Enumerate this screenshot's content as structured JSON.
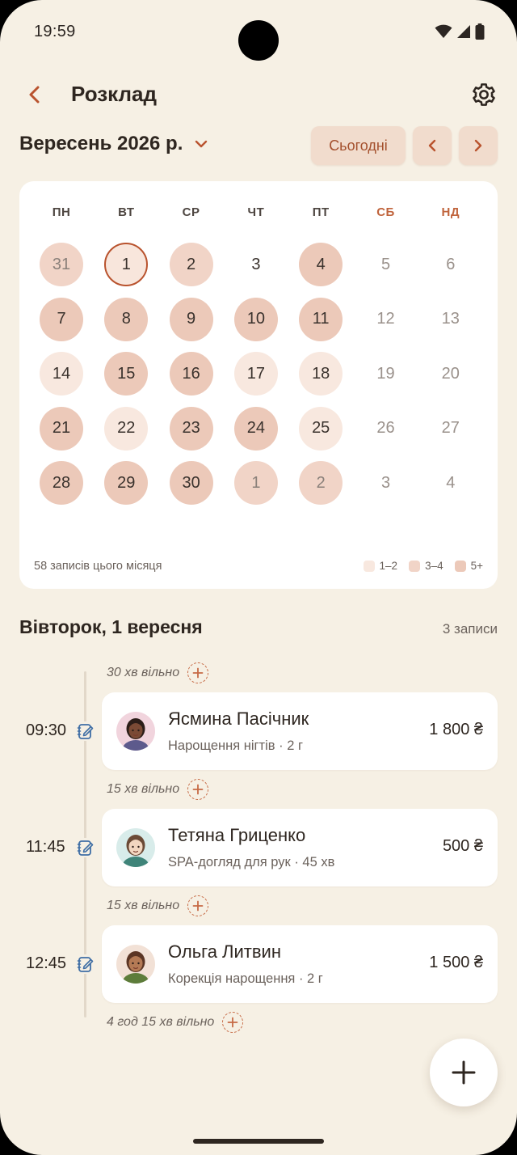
{
  "status_bar": {
    "time": "19:59",
    "icons": [
      "wifi-icon",
      "signal-icon",
      "battery-icon"
    ]
  },
  "header": {
    "title": "Розклад",
    "back_icon": "chevron-left-icon",
    "settings_icon": "gear-icon"
  },
  "month_nav": {
    "label": "Вересень 2026 р.",
    "today_label": "Сьогодні",
    "prev_icon": "chevron-left-icon",
    "next_icon": "chevron-right-icon"
  },
  "calendar": {
    "weekdays": [
      {
        "label": "ПН",
        "weekend": false
      },
      {
        "label": "ВТ",
        "weekend": false
      },
      {
        "label": "СР",
        "weekend": false
      },
      {
        "label": "ЧТ",
        "weekend": false
      },
      {
        "label": "ПТ",
        "weekend": false
      },
      {
        "label": "СБ",
        "weekend": true
      },
      {
        "label": "НД",
        "weekend": true
      }
    ],
    "weeks": [
      [
        {
          "d": "31",
          "level": 2,
          "other": true
        },
        {
          "d": "1",
          "level": 1,
          "selected": true
        },
        {
          "d": "2",
          "level": 2
        },
        {
          "d": "3",
          "level": 0
        },
        {
          "d": "4",
          "level": 3
        },
        {
          "d": "5",
          "level": 0,
          "muted": true
        },
        {
          "d": "6",
          "level": 0,
          "muted": true
        }
      ],
      [
        {
          "d": "7",
          "level": 3
        },
        {
          "d": "8",
          "level": 3
        },
        {
          "d": "9",
          "level": 3
        },
        {
          "d": "10",
          "level": 3
        },
        {
          "d": "11",
          "level": 3
        },
        {
          "d": "12",
          "level": 0,
          "muted": true
        },
        {
          "d": "13",
          "level": 0,
          "muted": true
        }
      ],
      [
        {
          "d": "14",
          "level": 1
        },
        {
          "d": "15",
          "level": 3
        },
        {
          "d": "16",
          "level": 3
        },
        {
          "d": "17",
          "level": 1
        },
        {
          "d": "18",
          "level": 1
        },
        {
          "d": "19",
          "level": 0,
          "muted": true
        },
        {
          "d": "20",
          "level": 0,
          "muted": true
        }
      ],
      [
        {
          "d": "21",
          "level": 3
        },
        {
          "d": "22",
          "level": 1
        },
        {
          "d": "23",
          "level": 3
        },
        {
          "d": "24",
          "level": 3
        },
        {
          "d": "25",
          "level": 1
        },
        {
          "d": "26",
          "level": 0,
          "muted": true
        },
        {
          "d": "27",
          "level": 0,
          "muted": true
        }
      ],
      [
        {
          "d": "28",
          "level": 3
        },
        {
          "d": "29",
          "level": 3
        },
        {
          "d": "30",
          "level": 3
        },
        {
          "d": "1",
          "level": 2,
          "other": true
        },
        {
          "d": "2",
          "level": 2,
          "other": true
        },
        {
          "d": "3",
          "level": 0,
          "other": true,
          "muted": true
        },
        {
          "d": "4",
          "level": 0,
          "other": true,
          "muted": true
        }
      ]
    ],
    "footer": "58 записів цього місяця",
    "legend": [
      {
        "label": "1–2",
        "color": "#f8e8df"
      },
      {
        "label": "3–4",
        "color": "#f1d4c7"
      },
      {
        "label": "5+",
        "color": "#ecc9b9"
      }
    ]
  },
  "day_view": {
    "title": "Вівторок, 1 вересня",
    "count": "3 записи",
    "slots": [
      {
        "type": "free",
        "text": "30 хв вільно"
      },
      {
        "type": "appt",
        "time": "09:30",
        "name": "Ясмина Пасічник",
        "desc": "Нарощення нігтів · 2 г",
        "price": "1 800 ₴",
        "avatar": {
          "bg": "#f1d4dd",
          "skin": "#7a4a35",
          "hair": "#2b1d18",
          "shirt": "#5d5a8c"
        }
      },
      {
        "type": "free",
        "text": "15 хв вільно"
      },
      {
        "type": "appt",
        "time": "11:45",
        "name": "Тетяна Гриценко",
        "desc": "SPA-догляд для рук · 45 хв",
        "price": "500 ₴",
        "avatar": {
          "bg": "#d8ecea",
          "skin": "#f2d6c0",
          "hair": "#6b4a36",
          "shirt": "#3f8479"
        }
      },
      {
        "type": "free",
        "text": "15 хв вільно"
      },
      {
        "type": "appt",
        "time": "12:45",
        "name": "Ольга Литвин",
        "desc": "Корекція нарощення · 2 г",
        "price": "1 500 ₴",
        "avatar": {
          "bg": "#f2e1d6",
          "skin": "#b47a55",
          "hair": "#5b3524",
          "shirt": "#5d7c3a"
        }
      },
      {
        "type": "free",
        "text": "4 год 15 хв вільно"
      }
    ]
  },
  "fab": {
    "icon": "plus-icon"
  },
  "colors": {
    "accent": "#b9532e",
    "background": "#f6f0e4",
    "card": "#ffffff"
  }
}
